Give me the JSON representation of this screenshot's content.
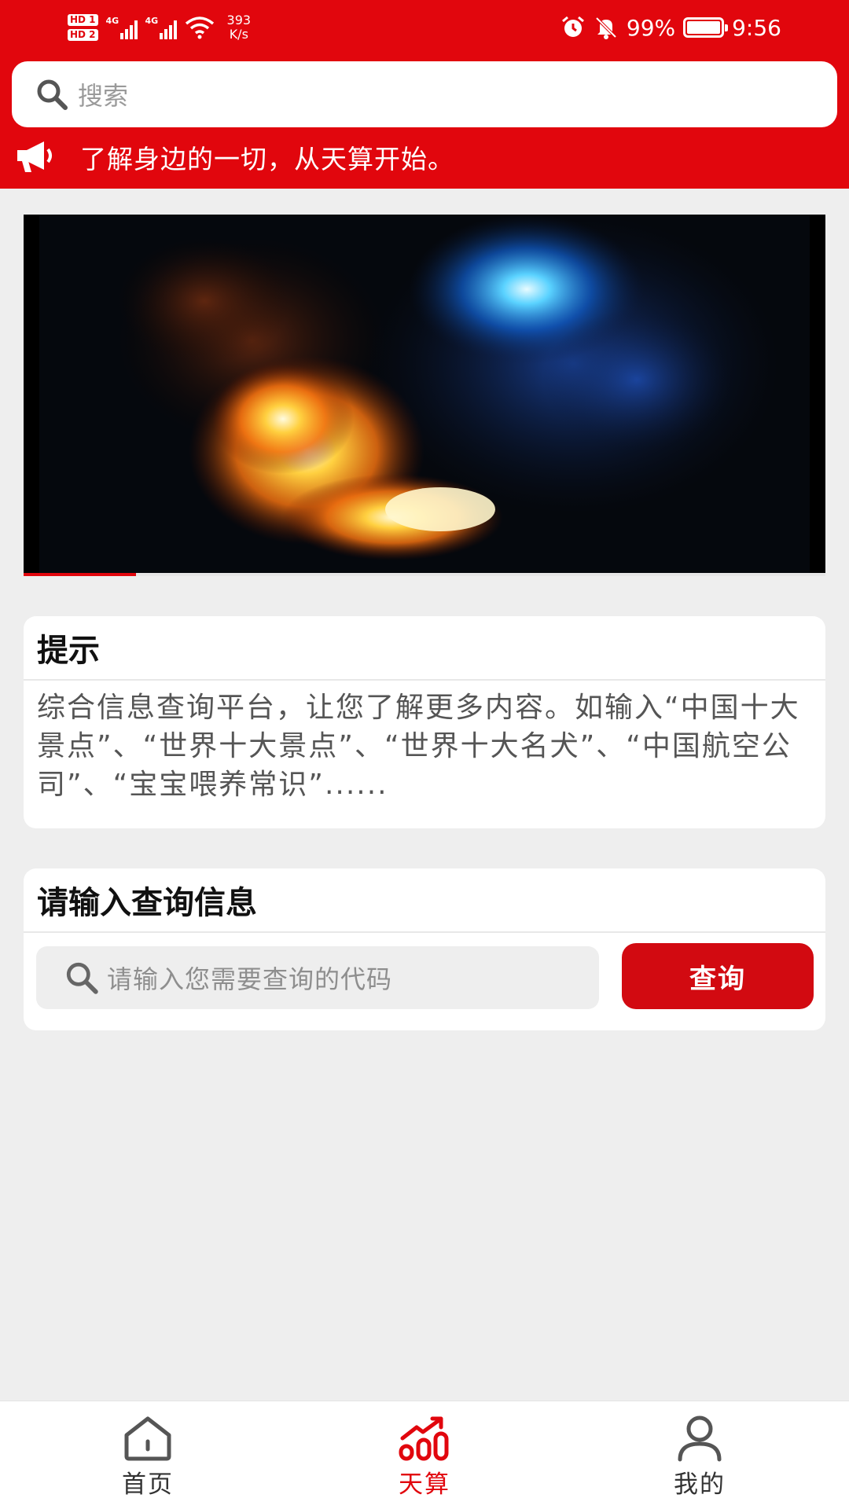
{
  "status_bar": {
    "hd1": "HD 1",
    "hd2": "HD 2",
    "net1": "4G",
    "net2": "4G",
    "net_speed": "393",
    "net_unit": "K/s",
    "battery": "99%",
    "time": "9:56",
    "battery_level": 0.99
  },
  "search": {
    "placeholder": "搜索"
  },
  "notice": {
    "text": "了解身边的一切，从天算开始。"
  },
  "video": {
    "progress": 0.14
  },
  "tip_card": {
    "title": "提示",
    "body": "综合信息查询平台，让您了解更多内容。如输入“中国十大景点”、“世界十大景点”、“世界十大名犬”、“中国航空公司”、“宝宝喂养常识”......"
  },
  "query_card": {
    "title": "请输入查询信息",
    "input_placeholder": "请输入您需要查询的代码",
    "button_label": "查询"
  },
  "tabbar": {
    "tabs": [
      {
        "label": "首页",
        "icon": "home-icon",
        "active": false
      },
      {
        "label": "天算",
        "icon": "chart-growth-icon",
        "active": true
      },
      {
        "label": "我的",
        "icon": "person-icon",
        "active": false
      }
    ]
  },
  "colors": {
    "brand_red": "#e1060d",
    "button_red": "#d20a11",
    "background": "#eeeeee"
  }
}
